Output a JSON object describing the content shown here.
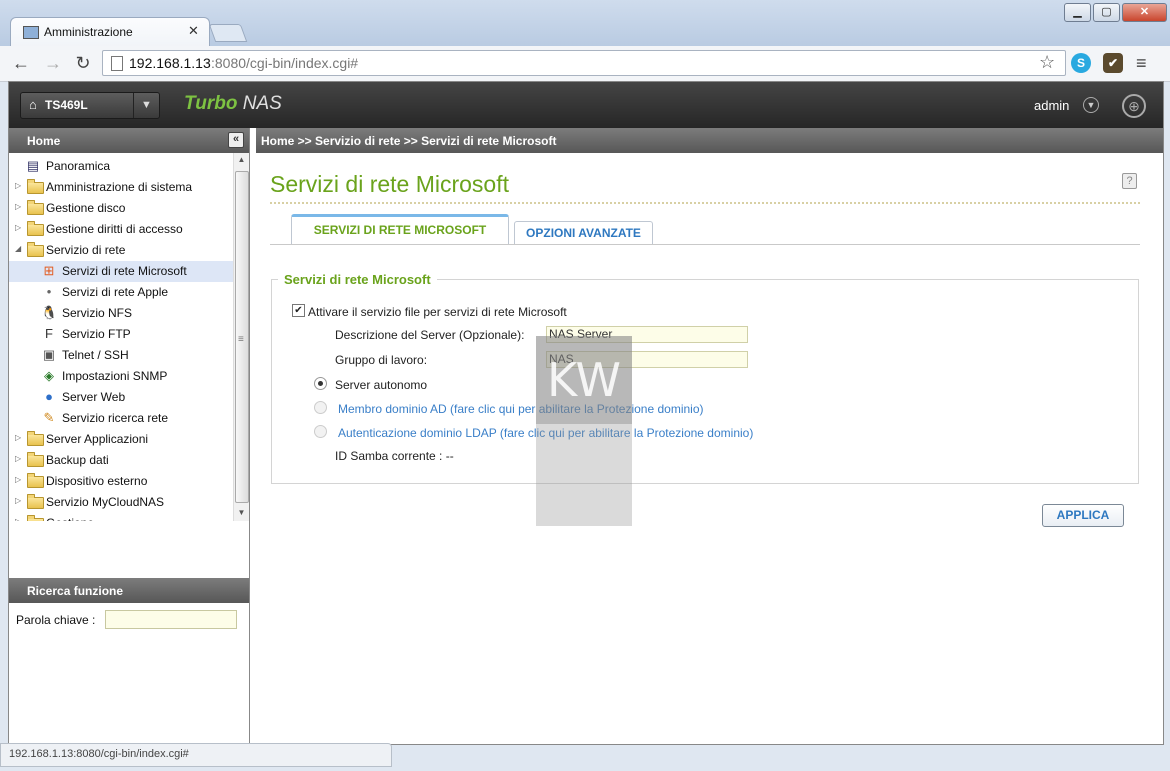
{
  "browser": {
    "tab_title": "Amministrazione",
    "url_host": "192.168.1.13",
    "url_rest": ":8080/cgi-bin/index.cgi#",
    "status_url": "192.168.1.13:8080/cgi-bin/index.cgi#"
  },
  "header": {
    "model": "TS469L",
    "brand_turbo": "Turbo",
    "brand_nas": " NAS",
    "user": "admin"
  },
  "sidebar": {
    "home_title": "Home",
    "tree": [
      {
        "label": "Panoramica",
        "type": "page",
        "icon": "overview-icon"
      },
      {
        "label": "Amministrazione di sistema",
        "type": "folder"
      },
      {
        "label": "Gestione disco",
        "type": "folder"
      },
      {
        "label": "Gestione diritti di accesso",
        "type": "folder"
      },
      {
        "label": "Servizio di rete",
        "type": "folder",
        "expanded": true
      },
      {
        "label": "Servizi di rete Microsoft",
        "type": "child",
        "icon": "windows-icon",
        "selected": true
      },
      {
        "label": "Servizi di rete Apple",
        "type": "child",
        "icon": "apple-icon"
      },
      {
        "label": "Servizio NFS",
        "type": "child",
        "icon": "linux-icon"
      },
      {
        "label": "Servizio FTP",
        "type": "child",
        "icon": "ftp-icon"
      },
      {
        "label": "Telnet / SSH",
        "type": "child",
        "icon": "terminal-icon"
      },
      {
        "label": "Impostazioni SNMP",
        "type": "child",
        "icon": "snmp-icon"
      },
      {
        "label": "Server Web",
        "type": "child",
        "icon": "web-globe-icon"
      },
      {
        "label": "Servizio ricerca rete",
        "type": "child",
        "icon": "network-discovery-icon"
      },
      {
        "label": "Server Applicazioni",
        "type": "folder"
      },
      {
        "label": "Backup dati",
        "type": "folder"
      },
      {
        "label": "Dispositivo esterno",
        "type": "folder"
      },
      {
        "label": "Servizio MyCloudNAS",
        "type": "folder"
      },
      {
        "label": "Gestione",
        "type": "folder"
      }
    ],
    "search_title": "Ricerca funzione",
    "keyword_label": "Parola chiave :",
    "keyword_value": ""
  },
  "main": {
    "breadcrumb": "Home >> Servizio di rete >> Servizi di rete Microsoft",
    "title": "Servizi di rete Microsoft",
    "tabs": [
      {
        "label": "SERVIZI DI RETE MICROSOFT",
        "active": true
      },
      {
        "label": "OPZIONI AVANZATE",
        "active": false
      }
    ],
    "section_legend": "Servizi di rete Microsoft",
    "enable_label": "Attivare il servizio file per servizi di rete Microsoft",
    "enable_checked": true,
    "desc_label": "Descrizione del Server (Opzionale):",
    "desc_value": "NAS Server",
    "group_label": "Gruppo di lavoro:",
    "group_value": "NAS",
    "radio_standalone": "Server autonomo",
    "radio_ad": "Membro dominio AD (fare clic qui per abilitare la Protezione dominio)",
    "radio_ldap": "Autenticazione dominio LDAP (fare clic qui per abilitare la Protezione dominio)",
    "samba_id": "ID Samba corrente : --",
    "apply_label": "APPLICA"
  },
  "watermark_text": "KW",
  "colors": {
    "accent_green": "#6aa31c",
    "link_blue": "#2e78c0"
  }
}
